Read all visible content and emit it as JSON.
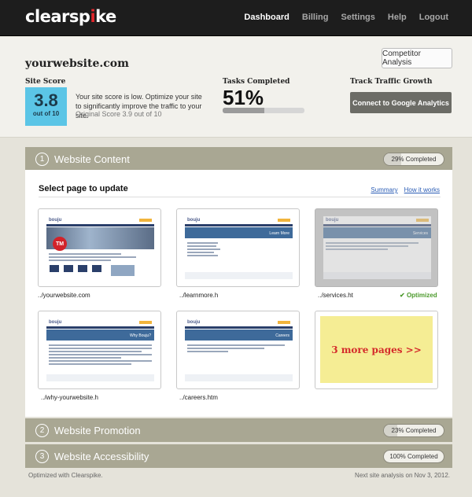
{
  "brand": {
    "logo_a": "clearsp",
    "logo_k": "i",
    "logo_b": "ke"
  },
  "nav": [
    "Dashboard",
    "Billing",
    "Settings",
    "Help",
    "Logout"
  ],
  "site": {
    "name": "yourwebsite.com",
    "competitor_btn": "Competitor Analysis"
  },
  "score": {
    "label": "Site Score",
    "value": "3.8",
    "out_of": "out of 10",
    "text": "Your site score is low. Optimize your site to significantly improve the traffic to your site.",
    "original": "Original Score 3.9 out of 10"
  },
  "tasks": {
    "label": "Tasks Completed",
    "value": "51%",
    "progress": 0.51
  },
  "traffic": {
    "label": "Track Traffic Growth",
    "btn": "Connect to Google Analytics"
  },
  "sections": [
    {
      "num": "1",
      "title": "Website Content",
      "status": "29% Completed",
      "progress": 0.29
    },
    {
      "num": "2",
      "title": "Website Promotion",
      "status": "23% Completed",
      "progress": 0.23
    },
    {
      "num": "3",
      "title": "Website Accessibility",
      "status": "100% Completed",
      "progress": 1.0
    }
  ],
  "content": {
    "select_label": "Select page to update",
    "summary_link": "Summary",
    "how_link": "How it works",
    "pages": [
      {
        "caption": "../yourwebsite.com",
        "brand": "bouju"
      },
      {
        "caption": "../learnmore.h",
        "brand": "bouju"
      },
      {
        "caption": "../services.ht",
        "brand": "bouju",
        "optimized": "Optimized"
      },
      {
        "caption": "../why-yourwebsite.h",
        "brand": "bouju"
      },
      {
        "caption": "../careers.htm",
        "brand": "bouju"
      }
    ],
    "more": "3 more pages >>"
  },
  "footer": {
    "left": "Optimized with Clearspike.",
    "right": "Next site analysis on Nov 3, 2012."
  },
  "colors": {
    "accent": "#5bc5e6",
    "section": "#a9a793",
    "more": "#f5ed94",
    "optimized": "#4c9a2c"
  }
}
